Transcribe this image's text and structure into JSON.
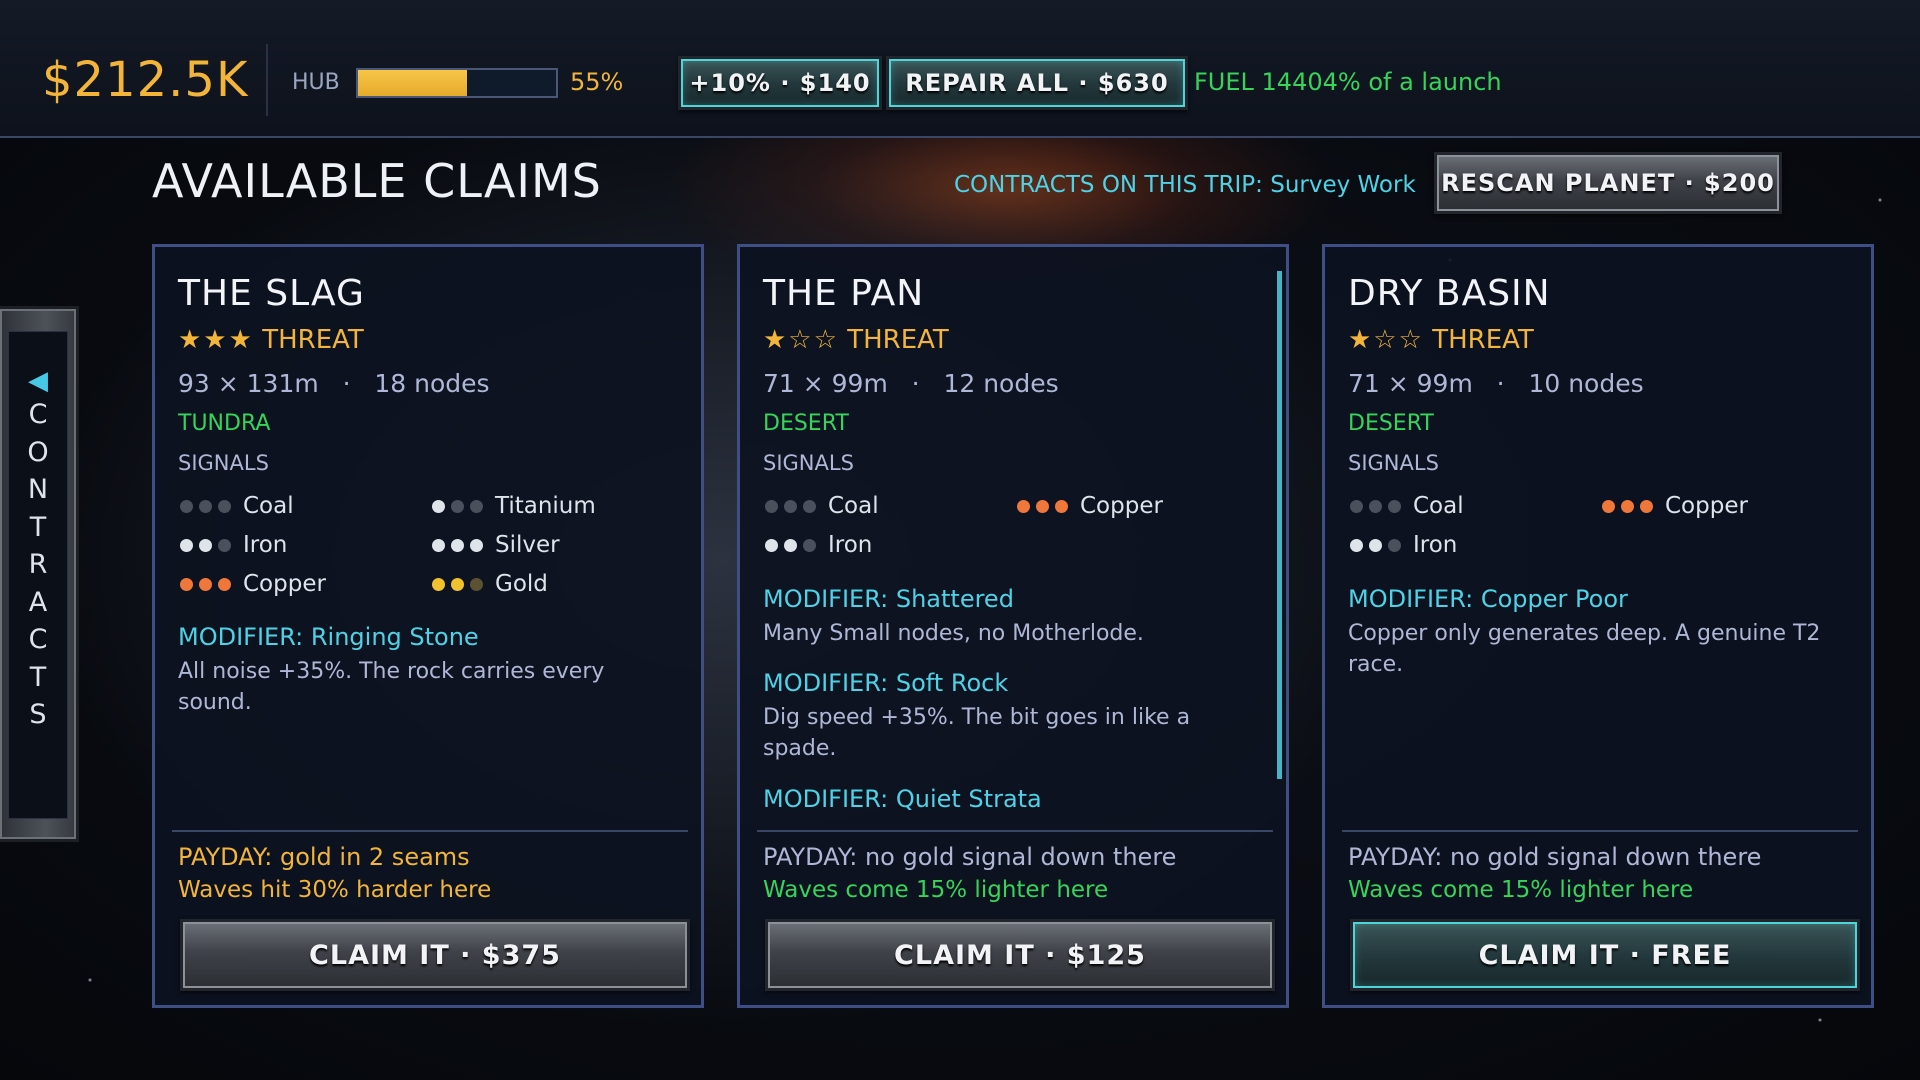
{
  "topbar": {
    "money": "$212.5K",
    "hub_label": "HUB",
    "hub_progress": 0.55,
    "hub_pct": "55%",
    "boost_button": "+10% · $140",
    "repair_button": "REPAIR ALL · $630",
    "fuel_text": "FUEL 14404% of a launch"
  },
  "header": {
    "title": "AVAILABLE CLAIMS",
    "contracts_line": "CONTRACTS ON THIS TRIP: Survey Work",
    "rescan_button": "RESCAN PLANET · $200"
  },
  "side_tab": {
    "arrow": "◀",
    "letters": [
      "C",
      "O",
      "N",
      "T",
      "R",
      "A",
      "C",
      "T",
      "S"
    ]
  },
  "colors": {
    "accent_gold": "#f2b53a",
    "accent_cyan": "#4ed2e6",
    "accent_green": "#36d45a",
    "dot_dim": "#4a505c",
    "dot_white": "#dfe3ea",
    "dot_orange": "#f0773a",
    "dot_gold": "#f2c12e"
  },
  "cards": [
    {
      "name": "THE SLAG",
      "threat_stars": "★★★",
      "threat_label": "THREAT",
      "dims": "93 × 131m   ·   18 nodes",
      "biome": "TUNDRA",
      "signals_label": "SIGNALS",
      "signals": [
        {
          "name": "Coal",
          "dots": [
            "dim",
            "dim",
            "dim"
          ]
        },
        {
          "name": "Titanium",
          "dots": [
            "white",
            "dim",
            "dim"
          ]
        },
        {
          "name": "Iron",
          "dots": [
            "white",
            "white",
            "dim"
          ]
        },
        {
          "name": "Silver",
          "dots": [
            "white",
            "white",
            "white"
          ]
        },
        {
          "name": "Copper",
          "dots": [
            "orange",
            "orange",
            "orange"
          ]
        },
        {
          "name": "Gold",
          "dots": [
            "gold",
            "gold",
            "dimgold"
          ]
        }
      ],
      "modifiers": [
        {
          "title": "MODIFIER: Ringing Stone",
          "desc": "All noise +35%. The rock carries every sound."
        }
      ],
      "payday": "PAYDAY: gold in 2 seams",
      "waves": "Waves hit 30% harder here",
      "claim_button": "CLAIM IT · $375"
    },
    {
      "name": "THE PAN",
      "threat_stars": "★☆☆",
      "threat_label": "THREAT",
      "dims": "71 × 99m   ·   12 nodes",
      "biome": "DESERT",
      "signals_label": "SIGNALS",
      "signals": [
        {
          "name": "Coal",
          "dots": [
            "dim",
            "dim",
            "dim"
          ]
        },
        {
          "name": "Copper",
          "dots": [
            "orange",
            "orange",
            "orange"
          ]
        },
        {
          "name": "Iron",
          "dots": [
            "white",
            "white",
            "dim"
          ]
        }
      ],
      "modifiers": [
        {
          "title": "MODIFIER: Shattered",
          "desc": "Many Small nodes, no Motherlode."
        },
        {
          "title": "MODIFIER: Soft Rock",
          "desc": "Dig speed +35%. The bit goes in like a spade."
        },
        {
          "title": "MODIFIER: Quiet Strata",
          "desc": ""
        }
      ],
      "payday": "PAYDAY: no gold signal down there",
      "waves": "Waves come 15% lighter here",
      "claim_button": "CLAIM IT · $125"
    },
    {
      "name": "DRY BASIN",
      "threat_stars": "★☆☆",
      "threat_label": "THREAT",
      "dims": "71 × 99m   ·   10 nodes",
      "biome": "DESERT",
      "signals_label": "SIGNALS",
      "signals": [
        {
          "name": "Coal",
          "dots": [
            "dim",
            "dim",
            "dim"
          ]
        },
        {
          "name": "Copper",
          "dots": [
            "orange",
            "orange",
            "orange"
          ]
        },
        {
          "name": "Iron",
          "dots": [
            "white",
            "white",
            "dim"
          ]
        }
      ],
      "modifiers": [
        {
          "title": "MODIFIER: Copper Poor",
          "desc": "Copper only generates deep. A genuine T2 race."
        }
      ],
      "payday": "PAYDAY: no gold signal down there",
      "waves": "Waves come 15% lighter here",
      "claim_button": "CLAIM IT · FREE"
    }
  ]
}
